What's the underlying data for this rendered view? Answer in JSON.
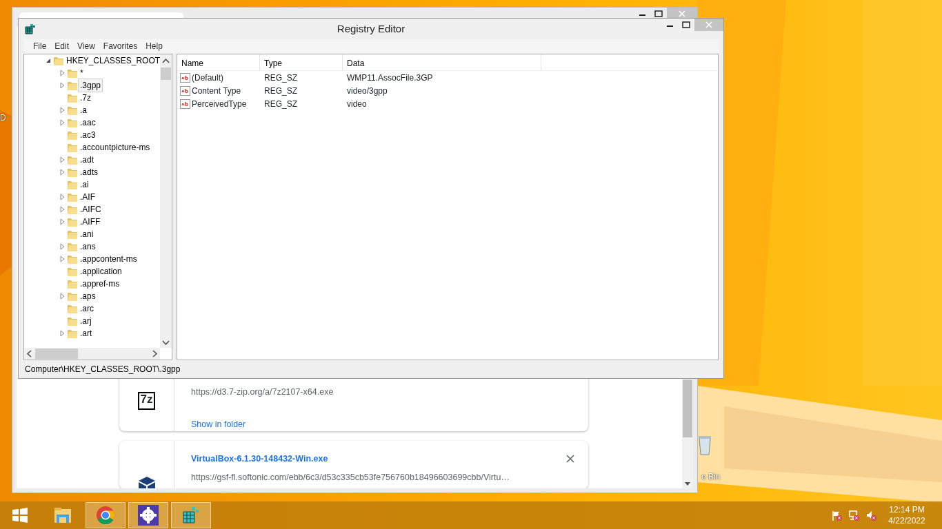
{
  "desktop_icons": [
    {
      "label": "D",
      "kind": "cut-left"
    },
    {
      "label": "e Bin",
      "kind": "recycle-bin"
    }
  ],
  "browser_window": {
    "downloads": [
      {
        "logo_text": "7z",
        "url": "https://d3.7-zip.org/a/7z2107-x64.exe",
        "link": "Show in folder"
      },
      {
        "title": "VirtualBox-6.1.30-148432-Win.exe",
        "url": "https://gsf-fl.softonic.com/ebb/6c3/d53c335cb53fe756760b18496603699cbb/Virtu…",
        "removable": true
      }
    ]
  },
  "window": {
    "title": "Registry Editor"
  },
  "menu": [
    "File",
    "Edit",
    "View",
    "Favorites",
    "Help"
  ],
  "tree": {
    "label": "HKEY_CLASSES_ROOT",
    "expanded": true,
    "children": [
      {
        "label": "*",
        "has_children": true,
        "selected": false
      },
      {
        "label": ".3gpp",
        "has_children": true,
        "selected": true
      },
      {
        "label": ".7z",
        "has_children": false,
        "selected": false
      },
      {
        "label": ".a",
        "has_children": true,
        "selected": false
      },
      {
        "label": ".aac",
        "has_children": true,
        "selected": false
      },
      {
        "label": ".ac3",
        "has_children": false,
        "selected": false
      },
      {
        "label": ".accountpicture-ms",
        "has_children": false,
        "selected": false
      },
      {
        "label": ".adt",
        "has_children": true,
        "selected": false
      },
      {
        "label": ".adts",
        "has_children": true,
        "selected": false
      },
      {
        "label": ".ai",
        "has_children": false,
        "selected": false
      },
      {
        "label": ".AIF",
        "has_children": true,
        "selected": false
      },
      {
        "label": ".AIFC",
        "has_children": true,
        "selected": false
      },
      {
        "label": ".AIFF",
        "has_children": true,
        "selected": false
      },
      {
        "label": ".ani",
        "has_children": false,
        "selected": false
      },
      {
        "label": ".ans",
        "has_children": true,
        "selected": false
      },
      {
        "label": ".appcontent-ms",
        "has_children": true,
        "selected": false
      },
      {
        "label": ".application",
        "has_children": false,
        "selected": false
      },
      {
        "label": ".appref-ms",
        "has_children": false,
        "selected": false
      },
      {
        "label": ".aps",
        "has_children": true,
        "selected": false
      },
      {
        "label": ".arc",
        "has_children": false,
        "selected": false
      },
      {
        "label": ".arj",
        "has_children": false,
        "selected": false
      },
      {
        "label": ".art",
        "has_children": true,
        "selected": false
      }
    ]
  },
  "table": {
    "columns": [
      "Name",
      "Type",
      "Data"
    ],
    "rows": [
      [
        "(Default)",
        "REG_SZ",
        "WMP11.AssocFile.3GP"
      ],
      [
        "Content Type",
        "REG_SZ",
        "video/3gpp"
      ],
      [
        "PerceivedType",
        "REG_SZ",
        "video"
      ]
    ]
  },
  "status_bar": "Computer\\HKEY_CLASSES_ROOT\\.3gpp",
  "taskbar": {
    "apps": [
      {
        "kind": "explorer",
        "active": false
      },
      {
        "kind": "chrome",
        "active": true
      },
      {
        "kind": "settings",
        "active": true
      },
      {
        "kind": "regedit",
        "active": true
      }
    ],
    "tray": [
      {
        "kind": "flag"
      },
      {
        "kind": "network"
      },
      {
        "kind": "speaker"
      }
    ],
    "time": "12:14 PM",
    "date": "4/22/2022"
  }
}
